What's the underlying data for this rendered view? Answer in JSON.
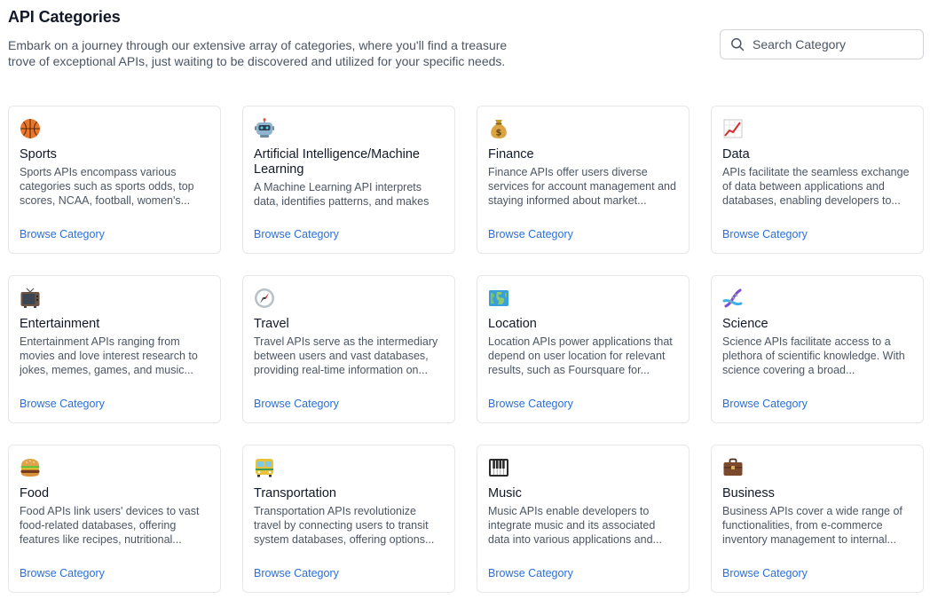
{
  "header": {
    "title": "API Categories",
    "description": "Embark on a journey through our extensive array of categories, where you'll find a treasure trove of exceptional APIs, just waiting to be discovered and utilized for your specific needs."
  },
  "search": {
    "placeholder": "Search Category",
    "icon": "search-icon"
  },
  "categories": [
    {
      "icon": "basketball-icon",
      "title": "Sports",
      "description": "Sports APIs encompass various categories such as sports odds, top scores, NCAA, football, women's...",
      "link": "Browse Category"
    },
    {
      "icon": "robot-icon",
      "title": "Artificial Intelligence/Machine Learning",
      "description": "A Machine Learning API interprets data, identifies patterns, and makes",
      "link": "Browse Category"
    },
    {
      "icon": "money-bag-icon",
      "title": "Finance",
      "description": "Finance APIs offer users diverse services for account management and staying informed about market...",
      "link": "Browse Category"
    },
    {
      "icon": "chart-increasing-icon",
      "title": "Data",
      "description": "APIs facilitate the seamless exchange of data between applications and databases, enabling developers to...",
      "link": "Browse Category"
    },
    {
      "icon": "television-icon",
      "title": "Entertainment",
      "description": "Entertainment APIs ranging from movies and love interest research to jokes, memes, games, and music...",
      "link": "Browse Category"
    },
    {
      "icon": "compass-icon",
      "title": "Travel",
      "description": "Travel APIs serve as the intermediary between users and vast databases, providing real-time information on...",
      "link": "Browse Category"
    },
    {
      "icon": "world-map-icon",
      "title": "Location",
      "description": "Location APIs power applications that depend on user location for relevant results, such as Foursquare for...",
      "link": "Browse Category"
    },
    {
      "icon": "dna-icon",
      "title": "Science",
      "description": "Science APIs facilitate access to a plethora of scientific knowledge. With science covering a broad...",
      "link": "Browse Category"
    },
    {
      "icon": "hamburger-icon",
      "title": "Food",
      "description": "Food APIs link users' devices to vast food-related databases, offering features like recipes, nutritional...",
      "link": "Browse Category"
    },
    {
      "icon": "bus-icon",
      "title": "Transportation",
      "description": "Transportation APIs revolutionize travel by connecting users to transit system databases, offering options...",
      "link": "Browse Category"
    },
    {
      "icon": "piano-keys-icon",
      "title": "Music",
      "description": "Music APIs enable developers to integrate music and its associated data into various applications and...",
      "link": "Browse Category"
    },
    {
      "icon": "briefcase-icon",
      "title": "Business",
      "description": "Business APIs cover a wide range of functionalities, from e-commerce inventory management to internal...",
      "link": "Browse Category"
    }
  ],
  "colors": {
    "link": "#2b6fd6",
    "border": "#e5e7eb",
    "title": "#111827",
    "body_text": "#4b5563"
  }
}
